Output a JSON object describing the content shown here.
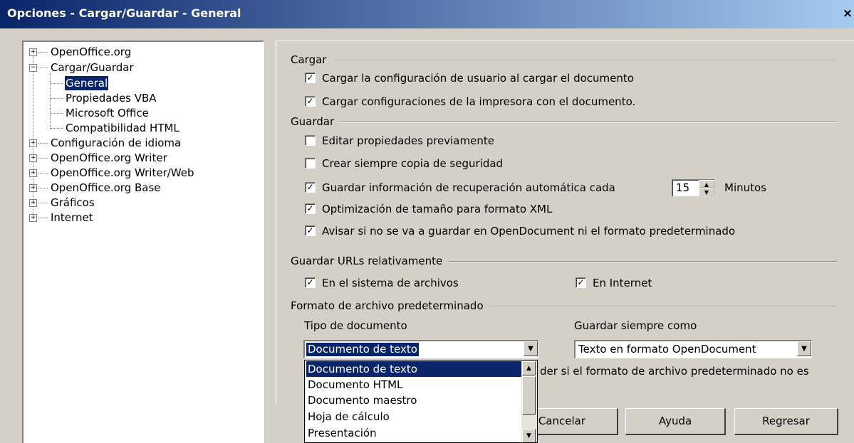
{
  "window": {
    "title": "Opciones - Cargar/Guardar - General",
    "close_glyph": "×"
  },
  "tree": {
    "items": [
      {
        "label": "OpenOffice.org",
        "expander": "+"
      },
      {
        "label": "Cargar/Guardar",
        "expander": "−"
      },
      {
        "label": "General"
      },
      {
        "label": "Propiedades VBA"
      },
      {
        "label": "Microsoft Office"
      },
      {
        "label": "Compatibilidad HTML"
      },
      {
        "label": "Configuración de idioma",
        "expander": "+"
      },
      {
        "label": "OpenOffice.org Writer",
        "expander": "+"
      },
      {
        "label": "OpenOffice.org Writer/Web",
        "expander": "+"
      },
      {
        "label": "OpenOffice.org Base",
        "expander": "+"
      },
      {
        "label": "Gráficos",
        "expander": "+"
      },
      {
        "label": "Internet",
        "expander": "+"
      }
    ]
  },
  "cargar": {
    "heading": "Cargar",
    "user_settings": {
      "label": "Cargar la configuración de usuario al cargar el documento",
      "checked": true
    },
    "printer_settings": {
      "label": "Cargar configuraciones de la impresora con el documento.",
      "checked": true
    }
  },
  "guardar": {
    "heading": "Guardar",
    "edit_props": {
      "label": "Editar propiedades previamente",
      "checked": false
    },
    "backup": {
      "label": "Crear siempre copia de seguridad",
      "checked": false
    },
    "autorecovery": {
      "label": "Guardar información de recuperación automática cada",
      "checked": true
    },
    "autorecovery_minutes": "15",
    "minutes_label": "Minutos",
    "xml_opt": {
      "label": "Optimización de tamaño para formato XML",
      "checked": true
    },
    "warn_odf": {
      "label": "Avisar si no se va a guardar en OpenDocument ni el formato predeterminado",
      "checked": true
    }
  },
  "urls": {
    "heading": "Guardar URLs relativamente",
    "filesystem": {
      "label": "En el sistema de archivos",
      "checked": true
    },
    "internet": {
      "label": "En Internet",
      "checked": true
    }
  },
  "formato": {
    "heading": "Formato de archivo predeterminado",
    "doc_type_label": "Tipo de documento",
    "save_as_label": "Guardar siempre como",
    "doc_type_value": "Documento de texto",
    "save_as_value": "Texto en formato OpenDocument",
    "warning_partial": "der si el formato de archivo predeterminado no es",
    "options": [
      "Documento de texto",
      "Documento HTML",
      "Documento maestro",
      "Hoja de cálculo",
      "Presentación"
    ]
  },
  "buttons": {
    "cancel": "Cancelar",
    "help": "Ayuda",
    "back": "Regresar"
  },
  "colors": {
    "selection": "#0a246a",
    "dialog_bg": "#d4d0c8"
  }
}
